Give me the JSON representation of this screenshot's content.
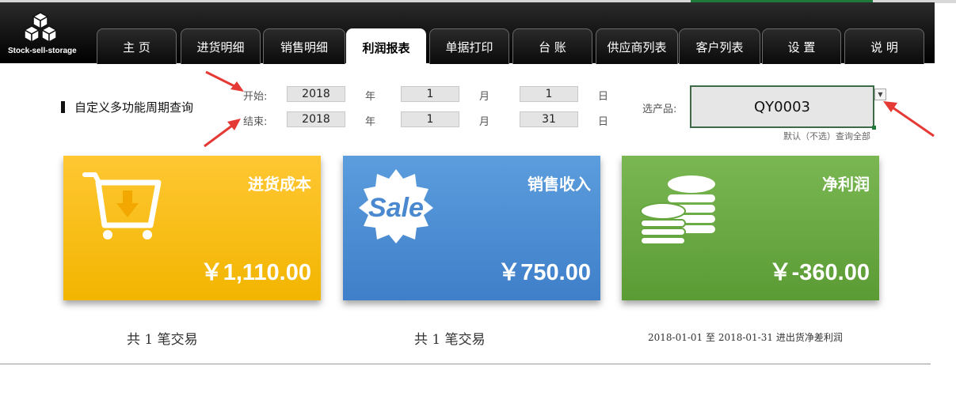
{
  "app": {
    "logo_text": "Stock-sell-storage"
  },
  "nav": {
    "tabs": [
      {
        "label": "主  页",
        "active": false
      },
      {
        "label": "进货明细",
        "active": false
      },
      {
        "label": "销售明细",
        "active": false
      },
      {
        "label": "利润报表",
        "active": true
      },
      {
        "label": "单据打印",
        "active": false
      },
      {
        "label": "台  账",
        "active": false
      },
      {
        "label": "供应商列表",
        "active": false
      },
      {
        "label": "客户列表",
        "active": false
      },
      {
        "label": "设  置",
        "active": false
      },
      {
        "label": "说  明",
        "active": false
      }
    ]
  },
  "query": {
    "section_title": "自定义多功能周期查询",
    "start_label": "开始:",
    "end_label": "结束:",
    "year_unit": "年",
    "month_unit": "月",
    "day_unit": "日",
    "start": {
      "year": "2018",
      "month": "1",
      "day": "1"
    },
    "end": {
      "year": "2018",
      "month": "1",
      "day": "31"
    },
    "product_label": "选产品:",
    "product_value": "QY0003",
    "product_hint": "默认（不选）查询全部"
  },
  "cards": [
    {
      "title": "进货成本",
      "amount": "￥1,110.00",
      "icon": "cart-down-icon",
      "color": "#f5b800"
    },
    {
      "title": "销售收入",
      "amount": "￥750.00",
      "icon": "sale-badge-icon",
      "color": "#4a8bd3"
    },
    {
      "title": "净利润",
      "amount": "￥-360.00",
      "icon": "coins-icon",
      "color": "#66a63f"
    }
  ],
  "footer": {
    "purchase_count": "共 1 笔交易",
    "sales_count": "共 1 笔交易",
    "period_text": "2018-01-01 至 2018-01-31 进出货净差利润"
  }
}
